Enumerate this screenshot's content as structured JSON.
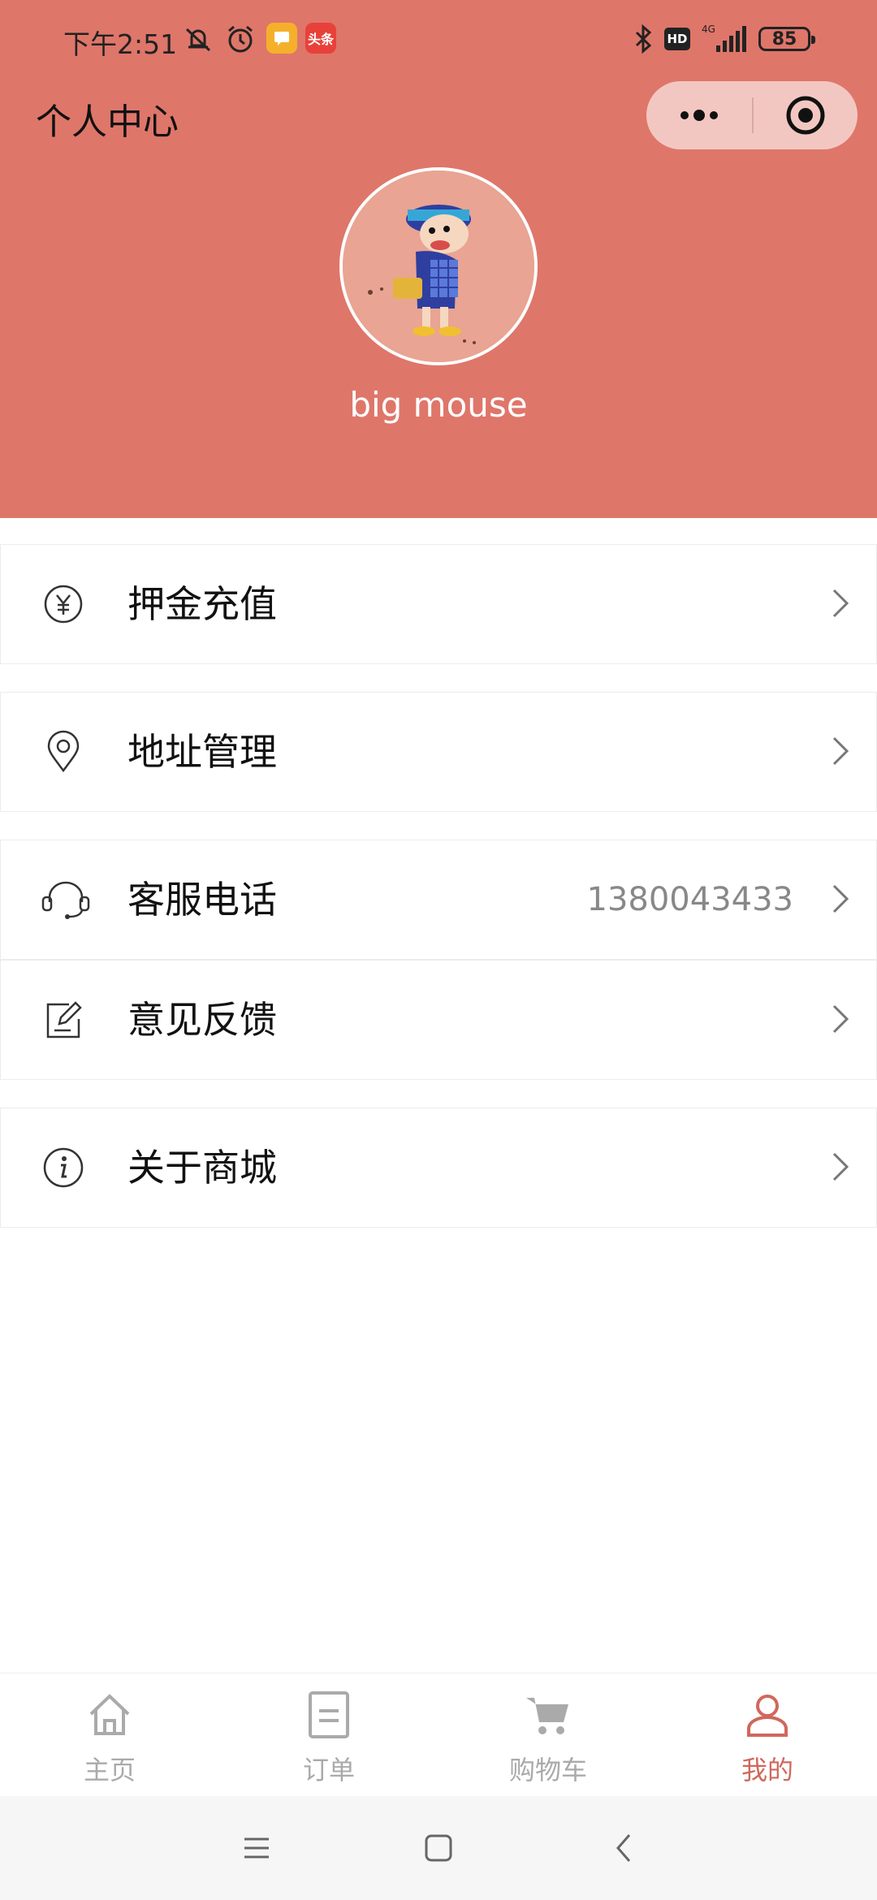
{
  "status_bar": {
    "time": "下午2:51",
    "app_badge_news": "头条",
    "battery": "85",
    "network": "4G"
  },
  "header": {
    "title": "个人中心",
    "username": "big mouse",
    "background_color": "#DF766A"
  },
  "menu": [
    {
      "label": "押金充值",
      "icon": "yuan-coin-icon",
      "value": ""
    },
    {
      "label": "地址管理",
      "icon": "location-pin-icon",
      "value": ""
    },
    {
      "label": "客服电话",
      "icon": "headset-icon",
      "value": "1380043433"
    },
    {
      "label": "意见反馈",
      "icon": "edit-note-icon",
      "value": ""
    },
    {
      "label": "关于商城",
      "icon": "info-icon",
      "value": ""
    }
  ],
  "tabbar": {
    "items": [
      {
        "label": "主页",
        "icon": "home-icon",
        "active": false
      },
      {
        "label": "订单",
        "icon": "order-icon",
        "active": false
      },
      {
        "label": "购物车",
        "icon": "cart-icon",
        "active": false
      },
      {
        "label": "我的",
        "icon": "user-icon",
        "active": true
      }
    ],
    "active_color": "#D0685C",
    "inactive_color": "#AAAAAA"
  },
  "system_nav": {
    "buttons": [
      "menu-icon",
      "home-square-icon",
      "back-icon"
    ]
  }
}
